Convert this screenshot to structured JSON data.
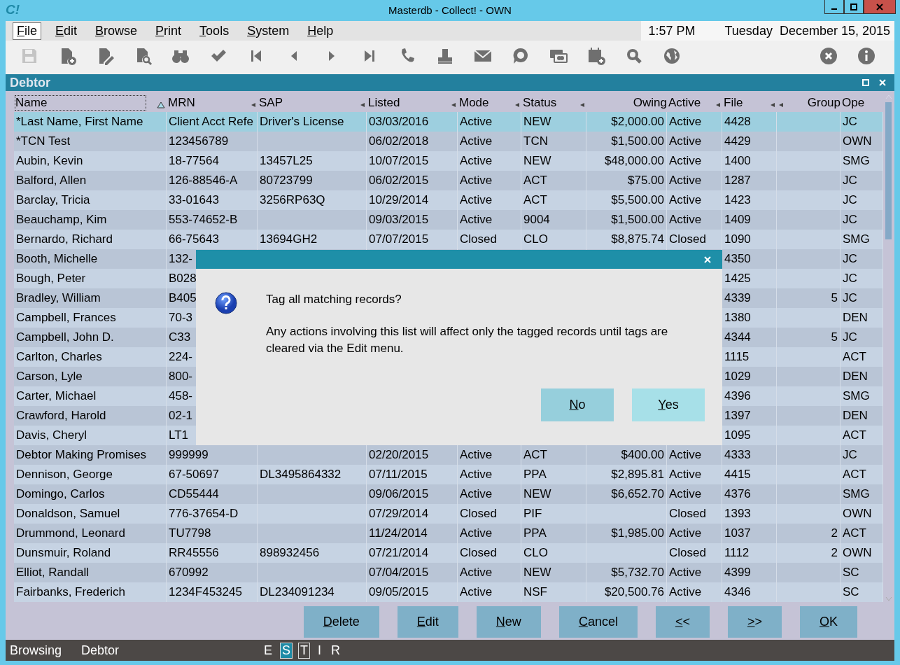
{
  "window": {
    "logo": "C!",
    "title": "Masterdb - Collect! - OWN"
  },
  "menu": [
    {
      "label": "File",
      "selected": true
    },
    {
      "label": "Edit",
      "selected": false
    },
    {
      "label": "Browse",
      "selected": false
    },
    {
      "label": "Print",
      "selected": false
    },
    {
      "label": "Tools",
      "selected": false
    },
    {
      "label": "System",
      "selected": false
    },
    {
      "label": "Help",
      "selected": false
    }
  ],
  "clock": {
    "time": "1:57 PM",
    "weekday": "Tuesday",
    "date": "December 15, 2015"
  },
  "toolbar": {
    "left": [
      {
        "kind": "save",
        "disabled": true
      },
      {
        "kind": "new",
        "disabled": false
      },
      {
        "kind": "edit",
        "disabled": false
      },
      {
        "kind": "find",
        "disabled": false
      },
      {
        "kind": "binoculars",
        "disabled": false
      },
      {
        "kind": "check",
        "disabled": false
      },
      {
        "kind": "first",
        "disabled": false
      },
      {
        "kind": "prev",
        "disabled": false
      },
      {
        "kind": "next",
        "disabled": false
      },
      {
        "kind": "last",
        "disabled": false
      },
      {
        "kind": "phone",
        "disabled": false
      },
      {
        "kind": "stamp",
        "disabled": false
      },
      {
        "kind": "mail",
        "disabled": false
      },
      {
        "kind": "chat",
        "disabled": false
      },
      {
        "kind": "card",
        "disabled": false
      },
      {
        "kind": "calendar",
        "disabled": false
      },
      {
        "kind": "search",
        "disabled": false
      },
      {
        "kind": "globe",
        "disabled": false
      }
    ],
    "right": [
      {
        "kind": "close",
        "disabled": false
      },
      {
        "kind": "info",
        "disabled": false
      }
    ]
  },
  "panel": {
    "title": "Debtor"
  },
  "table": {
    "columns": [
      {
        "label": "Name",
        "right_aligned": false,
        "sorted_ascending": true,
        "sort_marker": false
      },
      {
        "label": "MRN",
        "right_aligned": false,
        "sorted_ascending": false,
        "sort_marker": true
      },
      {
        "label": "SAP",
        "right_aligned": false,
        "sorted_ascending": false,
        "sort_marker": true
      },
      {
        "label": "Listed",
        "right_aligned": false,
        "sorted_ascending": false,
        "sort_marker": true
      },
      {
        "label": "Mode",
        "right_aligned": false,
        "sorted_ascending": false,
        "sort_marker": true
      },
      {
        "label": "Status",
        "right_aligned": false,
        "sorted_ascending": false,
        "sort_marker": true
      },
      {
        "label": "Owing",
        "right_aligned": true,
        "sorted_ascending": false,
        "sort_marker": false
      },
      {
        "label": "Active",
        "right_aligned": false,
        "sorted_ascending": false,
        "sort_marker": true
      },
      {
        "label": "File",
        "right_aligned": false,
        "sorted_ascending": false,
        "sort_marker": true
      },
      {
        "label": "Group",
        "right_aligned": true,
        "sorted_ascending": false,
        "sort_marker": true
      },
      {
        "label": "Ope",
        "right_aligned": false,
        "sorted_ascending": false,
        "sort_marker": false
      }
    ],
    "rows": [
      {
        "selected": true,
        "cells": [
          "*Last Name, First Name",
          "Client Acct Refe",
          "Driver's License",
          "03/03/2016",
          "Active",
          "NEW",
          "$2,000.00",
          "Active",
          "4428",
          null,
          "JC"
        ]
      },
      {
        "selected": false,
        "cells": [
          "*TCN Test",
          "123456789",
          null,
          "06/02/2018",
          "Active",
          "TCN",
          "$1,500.00",
          "Active",
          "4429",
          null,
          "OWN"
        ]
      },
      {
        "selected": false,
        "cells": [
          "Aubin, Kevin",
          "18-77564",
          "13457L25",
          "10/07/2015",
          "Active",
          "NEW",
          "$48,000.00",
          "Active",
          "1400",
          null,
          "SMG"
        ]
      },
      {
        "selected": false,
        "cells": [
          "Balford, Allen",
          "126-88546-A",
          "80723799",
          "06/02/2015",
          "Active",
          "ACT",
          "$75.00",
          "Active",
          "1287",
          null,
          "JC"
        ]
      },
      {
        "selected": false,
        "cells": [
          "Barclay, Tricia",
          "33-01643",
          "3256RP63Q",
          "10/29/2014",
          "Active",
          "ACT",
          "$5,500.00",
          "Active",
          "1423",
          null,
          "JC"
        ]
      },
      {
        "selected": false,
        "cells": [
          "Beauchamp, Kim",
          "553-74652-B",
          null,
          "09/03/2015",
          "Active",
          "9004",
          "$1,500.00",
          "Active",
          "1409",
          null,
          "JC"
        ]
      },
      {
        "selected": false,
        "cells": [
          "Bernardo, Richard",
          "66-75643",
          "13694GH2",
          "07/07/2015",
          "Closed",
          "CLO",
          "$8,875.74",
          "Closed",
          "1090",
          null,
          "SMG"
        ]
      },
      {
        "selected": false,
        "cells": [
          "Booth, Michelle",
          "132-",
          null,
          null,
          null,
          null,
          null,
          null,
          "4350",
          null,
          "JC"
        ]
      },
      {
        "selected": false,
        "cells": [
          "Bough, Peter",
          "B028",
          null,
          null,
          null,
          null,
          null,
          null,
          "1425",
          null,
          "JC"
        ]
      },
      {
        "selected": false,
        "cells": [
          "Bradley, William",
          "B405",
          null,
          null,
          null,
          null,
          null,
          null,
          "4339",
          "5",
          "JC"
        ]
      },
      {
        "selected": false,
        "cells": [
          "Campbell, Frances",
          "70-3",
          null,
          null,
          null,
          null,
          null,
          null,
          "1380",
          null,
          "DEN"
        ]
      },
      {
        "selected": false,
        "cells": [
          "Campbell, John D.",
          "C33",
          null,
          null,
          null,
          null,
          null,
          null,
          "4344",
          "5",
          "JC"
        ]
      },
      {
        "selected": false,
        "cells": [
          "Carlton, Charles",
          "224-",
          null,
          null,
          null,
          null,
          null,
          null,
          "1115",
          null,
          "ACT"
        ]
      },
      {
        "selected": false,
        "cells": [
          "Carson, Lyle",
          "800-",
          null,
          null,
          null,
          null,
          null,
          null,
          "1029",
          null,
          "DEN"
        ]
      },
      {
        "selected": false,
        "cells": [
          "Carter, Michael",
          "458-",
          null,
          null,
          null,
          null,
          null,
          null,
          "4396",
          null,
          "SMG"
        ]
      },
      {
        "selected": false,
        "cells": [
          "Crawford, Harold",
          "02-1",
          null,
          null,
          null,
          null,
          null,
          null,
          "1397",
          null,
          "DEN"
        ]
      },
      {
        "selected": false,
        "cells": [
          "Davis, Cheryl",
          "LT1",
          null,
          null,
          null,
          null,
          null,
          null,
          "1095",
          null,
          "ACT"
        ]
      },
      {
        "selected": false,
        "cells": [
          "Debtor Making Promises",
          "999999",
          null,
          "02/20/2015",
          "Active",
          "ACT",
          "$400.00",
          "Active",
          "4333",
          null,
          "JC"
        ]
      },
      {
        "selected": false,
        "cells": [
          "Dennison, George",
          "67-50697",
          "DL3495864332",
          "07/11/2015",
          "Active",
          "PPA",
          "$2,895.81",
          "Active",
          "4415",
          null,
          "ACT"
        ]
      },
      {
        "selected": false,
        "cells": [
          "Domingo, Carlos",
          "CD55444",
          null,
          "09/06/2015",
          "Active",
          "NEW",
          "$6,652.70",
          "Active",
          "4376",
          null,
          "SMG"
        ]
      },
      {
        "selected": false,
        "cells": [
          "Donaldson, Samuel",
          "776-37654-D",
          null,
          "07/29/2014",
          "Closed",
          "PIF",
          null,
          "Closed",
          "1393",
          null,
          "OWN"
        ]
      },
      {
        "selected": false,
        "cells": [
          "Drummond, Leonard",
          "TU7798",
          null,
          "11/24/2014",
          "Active",
          "PPA",
          "$1,985.00",
          "Active",
          "1037",
          "2",
          "ACT"
        ]
      },
      {
        "selected": false,
        "cells": [
          "Dunsmuir, Roland",
          "RR45556",
          "898932456",
          "07/21/2014",
          "Closed",
          "CLO",
          null,
          "Closed",
          "1112",
          "2",
          "OWN"
        ]
      },
      {
        "selected": false,
        "cells": [
          "Elliot, Randall",
          "670992",
          null,
          "07/04/2015",
          "Active",
          "NEW",
          "$5,732.70",
          "Active",
          "4399",
          null,
          "SC"
        ]
      },
      {
        "selected": false,
        "cells": [
          "Fairbanks, Frederich",
          "1234F453245",
          "DL234091234",
          "09/05/2015",
          "Active",
          "NSF",
          "$20,500.76",
          "Active",
          "4346",
          null,
          "SC"
        ]
      }
    ]
  },
  "buttons": [
    {
      "label": "Delete"
    },
    {
      "label": "Edit"
    },
    {
      "label": "New"
    },
    {
      "label": "Cancel"
    },
    {
      "label": "<<"
    },
    {
      "label": ">>"
    },
    {
      "label": "OK"
    }
  ],
  "dialog": {
    "question": "Tag all matching records?",
    "message": "Any actions involving this list will affect only the tagged records until tags are cleared via the Edit menu.",
    "buttons": [
      {
        "label": "No",
        "default": false
      },
      {
        "label": "Yes",
        "default": true
      }
    ]
  },
  "status_bar": {
    "mode": "Browsing",
    "table": "Debtor",
    "flags": [
      {
        "label": "E",
        "highlighted": false,
        "boxed": false
      },
      {
        "label": "S",
        "highlighted": true,
        "boxed": false
      },
      {
        "label": "T",
        "highlighted": false,
        "boxed": true
      },
      {
        "label": "I",
        "highlighted": false,
        "boxed": false
      },
      {
        "label": "R",
        "highlighted": false,
        "boxed": false
      }
    ]
  }
}
